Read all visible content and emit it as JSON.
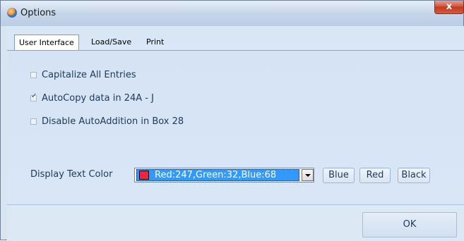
{
  "window": {
    "title": "Options",
    "close_glyph": "x",
    "icon": "app-logo-icon"
  },
  "tabs": [
    {
      "label": "User Interface",
      "active": true
    },
    {
      "label": "Load/Save",
      "active": false
    },
    {
      "label": "Print",
      "active": false
    }
  ],
  "options": [
    {
      "label": "Capitalize All Entries",
      "checked": false
    },
    {
      "label": "AutoCopy data in 24A - J",
      "checked": true
    },
    {
      "label": "Disable AutoAddition in Box 28",
      "checked": false
    }
  ],
  "display_color": {
    "label": "Display Text Color",
    "selected": "Red:247,Green:32,Blue:68",
    "swatch_color": "#f72044",
    "buttons": [
      "Blue",
      "Red",
      "Black"
    ]
  },
  "footer": {
    "ok_label": "OK"
  }
}
